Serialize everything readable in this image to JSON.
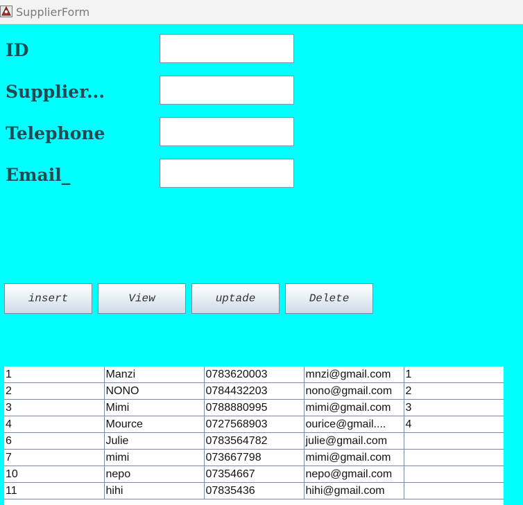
{
  "window": {
    "title": "SupplierForm",
    "icon": "java-app-icon"
  },
  "form": {
    "fields": [
      {
        "label": "ID",
        "value": ""
      },
      {
        "label": "Supplier...",
        "value": ""
      },
      {
        "label": "Telephone",
        "value": ""
      },
      {
        "label": "Email_",
        "value": ""
      }
    ]
  },
  "buttons": {
    "insert": "insert",
    "view": "View",
    "update": "uptade",
    "delete": "Delete"
  },
  "table": {
    "rows": [
      [
        "1",
        "Manzi",
        "0783620003",
        "mnzi@gmail.com",
        "1"
      ],
      [
        "2",
        "NONO",
        "0784432203",
        "nono@gmail.com",
        "2"
      ],
      [
        "3",
        "Mimi",
        "0788880995",
        "mimi@gmail.com",
        "3"
      ],
      [
        "4",
        "Mource",
        "0727568903",
        "ourice@gmail....",
        "4"
      ],
      [
        "6",
        "Julie",
        "0783564782",
        "julie@gmail.com",
        ""
      ],
      [
        "7",
        "mimi",
        "073667798",
        "mimi@gmail.com",
        ""
      ],
      [
        "10",
        "nepo",
        "07354667",
        "nepo@gmail.com",
        ""
      ],
      [
        "11",
        "hihi",
        "07835436",
        "hihi@gmail.com",
        ""
      ]
    ]
  },
  "colors": {
    "background": "#00ffff",
    "label": "#1f4a52",
    "grid_line": "#7a8aa0"
  }
}
